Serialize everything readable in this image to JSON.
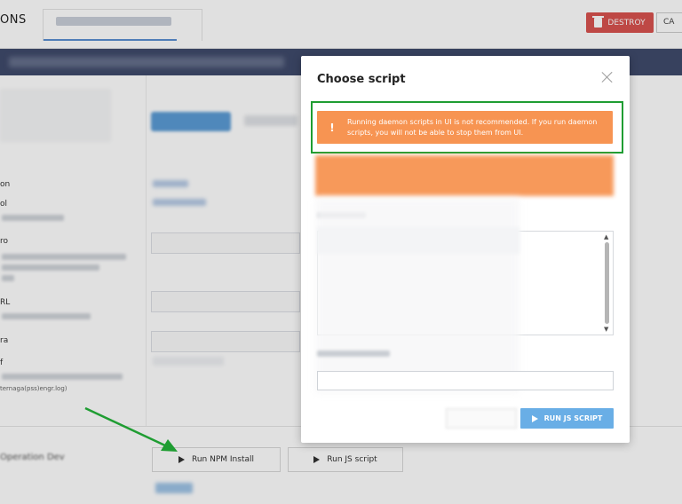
{
  "app": {
    "title": "ONS"
  },
  "toolbar": {
    "destroy_label": "DESTROY",
    "cancel_label": "CA"
  },
  "sidebar": {
    "labels": [
      "on",
      "ol",
      "ro",
      "RL",
      "ra",
      "f"
    ],
    "sublabel": "ternaga(pss)engr.log)"
  },
  "footer": {
    "run_npm_label": "Run NPM Install",
    "run_js_label": "Run JS script"
  },
  "modal": {
    "title": "Choose script",
    "alert": {
      "icon": "!",
      "text": "Running daemon scripts in UI is not recommended. If you run daemon scripts, you will not be able to stop them from UI."
    },
    "params_value": "",
    "run_button_label": "RUN JS SCRIPT",
    "colors": {
      "alert": "#f79452",
      "primary": "#69aee6",
      "annotation": "#1f9d32",
      "destroy": "#d9534f"
    }
  },
  "icons": {
    "close": "close-icon",
    "warning": "exclamation-icon",
    "play": "play-icon",
    "trash": "trash-icon"
  }
}
